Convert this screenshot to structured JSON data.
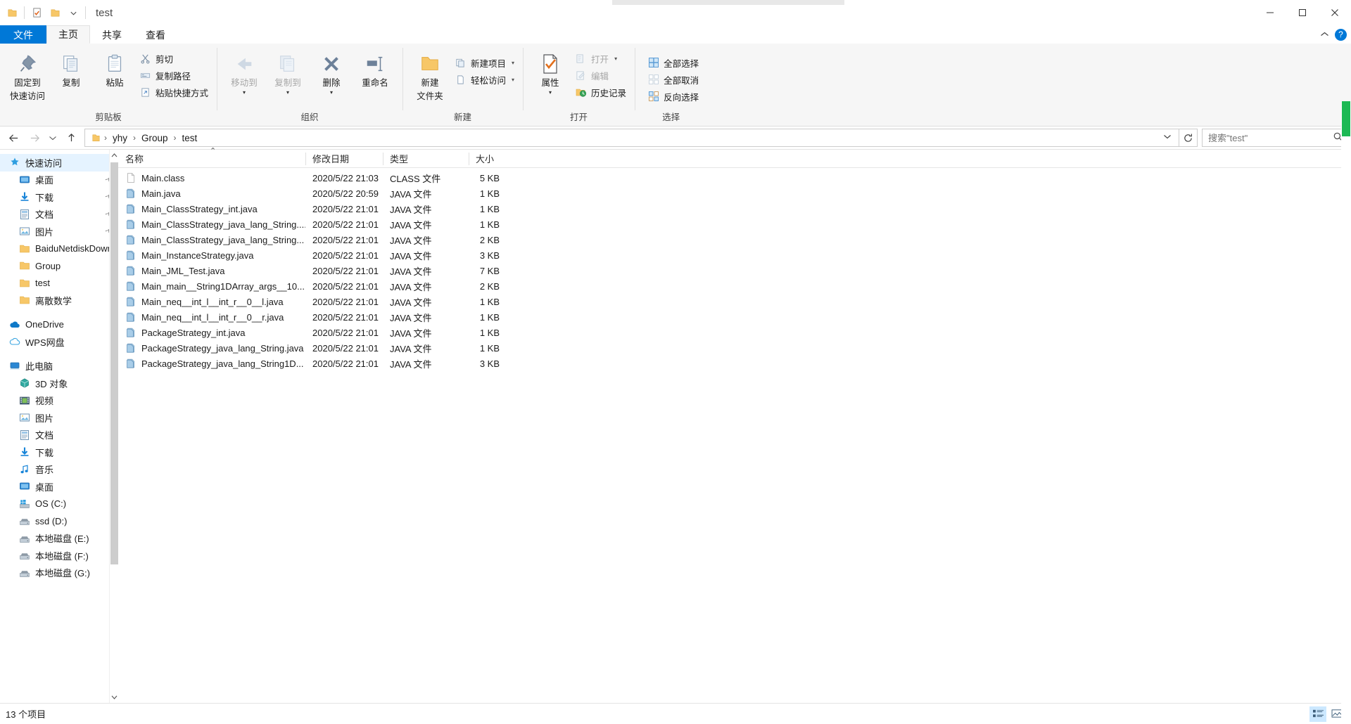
{
  "window": {
    "title": "test",
    "minimize_label": "─",
    "maximize_label": "☐",
    "close_label": "✕"
  },
  "quick_access_toolbar": [
    {
      "name": "properties-qat",
      "icon": "folder-icon"
    },
    {
      "name": "new-folder-qat",
      "icon": "checklist-icon"
    },
    {
      "name": "folder-qat",
      "icon": "folder-icon"
    },
    {
      "name": "customize-qat",
      "icon": "chevron-down-icon"
    }
  ],
  "tabs": [
    {
      "label": "文件",
      "key": "file"
    },
    {
      "label": "主页",
      "key": "home"
    },
    {
      "label": "共享",
      "key": "share"
    },
    {
      "label": "查看",
      "key": "view"
    }
  ],
  "ribbon": {
    "collapse_icon": "chevron-up-icon",
    "help_icon": "question-mark-icon",
    "groups": [
      {
        "label": "剪贴板",
        "big_buttons": [
          {
            "label": "固定到\n快速访问",
            "line1": "固定到",
            "line2": "快速访问",
            "icon": "pin-icon",
            "disabled": false
          },
          {
            "label": "复制",
            "line1": "复制",
            "line2": "",
            "icon": "copy-icon",
            "disabled": false
          },
          {
            "label": "粘贴",
            "line1": "粘贴",
            "line2": "",
            "icon": "paste-icon",
            "disabled": false
          }
        ],
        "small_buttons": [
          {
            "label": "剪切",
            "icon": "scissors-icon",
            "disabled": false
          },
          {
            "label": "复制路径",
            "icon": "copy-path-icon",
            "disabled": false
          },
          {
            "label": "粘贴快捷方式",
            "icon": "paste-shortcut-icon",
            "disabled": false
          }
        ]
      },
      {
        "label": "组织",
        "big_buttons": [
          {
            "line1": "移动到",
            "line2": "",
            "icon": "move-to-icon",
            "disabled": true,
            "caret": true
          },
          {
            "line1": "复制到",
            "line2": "",
            "icon": "copy-to-icon",
            "disabled": true,
            "caret": true
          },
          {
            "line1": "删除",
            "line2": "",
            "icon": "delete-x-icon",
            "disabled": false,
            "caret": true
          },
          {
            "line1": "重命名",
            "line2": "",
            "icon": "rename-icon",
            "disabled": false
          }
        ],
        "small_buttons": []
      },
      {
        "label": "新建",
        "big_buttons": [
          {
            "line1": "新建",
            "line2": "文件夹",
            "icon": "new-folder-icon",
            "disabled": false
          }
        ],
        "small_buttons": [
          {
            "label": "新建项目",
            "icon": "new-item-icon",
            "caret": true,
            "disabled": false
          },
          {
            "label": "轻松访问",
            "icon": "easy-access-icon",
            "caret": true,
            "disabled": false
          }
        ]
      },
      {
        "label": "打开",
        "big_buttons": [
          {
            "line1": "属性",
            "line2": "",
            "icon": "properties-check-icon",
            "disabled": false,
            "caret": true
          }
        ],
        "small_buttons": [
          {
            "label": "打开",
            "icon": "open-icon",
            "caret": true,
            "disabled": true
          },
          {
            "label": "编辑",
            "icon": "edit-icon",
            "disabled": true
          },
          {
            "label": "历史记录",
            "icon": "history-icon",
            "disabled": false
          }
        ]
      },
      {
        "label": "选择",
        "big_buttons": [],
        "small_buttons": [
          {
            "label": "全部选择",
            "icon": "select-all-icon",
            "disabled": false
          },
          {
            "label": "全部取消",
            "icon": "select-none-icon",
            "disabled": false
          },
          {
            "label": "反向选择",
            "icon": "invert-selection-icon",
            "disabled": false
          }
        ]
      }
    ]
  },
  "address": {
    "back_icon": "arrow-left-icon",
    "forward_icon": "arrow-right-icon",
    "recent_icon": "chevron-down-icon",
    "up_icon": "arrow-up-icon",
    "folder_icon": "folder-icon",
    "separator": "›",
    "crumbs": [
      "yhy",
      "Group",
      "test"
    ],
    "dropdown_icon": "chevron-down-icon",
    "refresh_icon": "refresh-icon"
  },
  "search": {
    "placeholder": "搜索\"test\"",
    "value": "",
    "icon": "search-icon"
  },
  "sidebar": {
    "items": [
      {
        "label": "快速访问",
        "icon": "star-icon",
        "level": 0,
        "selected": true,
        "pinned": false
      },
      {
        "label": "桌面",
        "icon": "desktop-icon",
        "level": 1,
        "selected": false,
        "pinned": true
      },
      {
        "label": "下载",
        "icon": "download-icon",
        "level": 1,
        "selected": false,
        "pinned": true
      },
      {
        "label": "文档",
        "icon": "documents-icon",
        "level": 1,
        "selected": false,
        "pinned": true
      },
      {
        "label": "图片",
        "icon": "pictures-icon",
        "level": 1,
        "selected": false,
        "pinned": true
      },
      {
        "label": "BaiduNetdiskDown",
        "icon": "folder-icon",
        "level": 1,
        "selected": false,
        "pinned": false
      },
      {
        "label": "Group",
        "icon": "folder-icon",
        "level": 1,
        "selected": false,
        "pinned": false
      },
      {
        "label": "test",
        "icon": "folder-icon",
        "level": 1,
        "selected": false,
        "pinned": false
      },
      {
        "label": "离散数学",
        "icon": "folder-icon",
        "level": 1,
        "selected": false,
        "pinned": false
      },
      {
        "label": "__GAP__",
        "icon": "",
        "level": 0,
        "selected": false,
        "pinned": false
      },
      {
        "label": "OneDrive",
        "icon": "onedrive-cloud-icon",
        "level": 0,
        "selected": false,
        "pinned": false
      },
      {
        "label": "WPS网盘",
        "icon": "wps-cloud-icon",
        "level": 0,
        "selected": false,
        "pinned": false
      },
      {
        "label": "__GAP__",
        "icon": "",
        "level": 0,
        "selected": false,
        "pinned": false
      },
      {
        "label": "此电脑",
        "icon": "this-pc-icon",
        "level": 0,
        "selected": false,
        "pinned": false
      },
      {
        "label": "3D 对象",
        "icon": "3d-objects-icon",
        "level": 1,
        "selected": false,
        "pinned": false
      },
      {
        "label": "视频",
        "icon": "videos-icon",
        "level": 1,
        "selected": false,
        "pinned": false
      },
      {
        "label": "图片",
        "icon": "pictures-icon",
        "level": 1,
        "selected": false,
        "pinned": false
      },
      {
        "label": "文档",
        "icon": "documents-icon",
        "level": 1,
        "selected": false,
        "pinned": false
      },
      {
        "label": "下载",
        "icon": "download-icon",
        "level": 1,
        "selected": false,
        "pinned": false
      },
      {
        "label": "音乐",
        "icon": "music-note-icon",
        "level": 1,
        "selected": false,
        "pinned": false
      },
      {
        "label": "桌面",
        "icon": "desktop-icon",
        "level": 1,
        "selected": false,
        "pinned": false
      },
      {
        "label": "OS (C:)",
        "icon": "windows-drive-icon",
        "level": 1,
        "selected": false,
        "pinned": false
      },
      {
        "label": "ssd (D:)",
        "icon": "drive-icon",
        "level": 1,
        "selected": false,
        "pinned": false
      },
      {
        "label": "本地磁盘 (E:)",
        "icon": "drive-icon",
        "level": 1,
        "selected": false,
        "pinned": false
      },
      {
        "label": "本地磁盘 (F:)",
        "icon": "drive-icon",
        "level": 1,
        "selected": false,
        "pinned": false
      },
      {
        "label": "本地磁盘 (G:)",
        "icon": "drive-icon",
        "level": 1,
        "selected": false,
        "pinned": false
      }
    ]
  },
  "filelist": {
    "columns": [
      {
        "label": "名称",
        "key": "name"
      },
      {
        "label": "修改日期",
        "key": "date"
      },
      {
        "label": "类型",
        "key": "type"
      },
      {
        "label": "大小",
        "key": "size"
      }
    ],
    "sort_indicator": "⌃",
    "rows": [
      {
        "name": "Main.class",
        "date": "2020/5/22 21:03",
        "type": "CLASS 文件",
        "size": "5 KB",
        "icon": "generic-file-icon"
      },
      {
        "name": "Main.java",
        "date": "2020/5/22 20:59",
        "type": "JAVA 文件",
        "size": "1 KB",
        "icon": "java-file-icon"
      },
      {
        "name": "Main_ClassStrategy_int.java",
        "date": "2020/5/22 21:01",
        "type": "JAVA 文件",
        "size": "1 KB",
        "icon": "java-file-icon"
      },
      {
        "name": "Main_ClassStrategy_java_lang_String....",
        "date": "2020/5/22 21:01",
        "type": "JAVA 文件",
        "size": "1 KB",
        "icon": "java-file-icon"
      },
      {
        "name": "Main_ClassStrategy_java_lang_String...",
        "date": "2020/5/22 21:01",
        "type": "JAVA 文件",
        "size": "2 KB",
        "icon": "java-file-icon"
      },
      {
        "name": "Main_InstanceStrategy.java",
        "date": "2020/5/22 21:01",
        "type": "JAVA 文件",
        "size": "3 KB",
        "icon": "java-file-icon"
      },
      {
        "name": "Main_JML_Test.java",
        "date": "2020/5/22 21:01",
        "type": "JAVA 文件",
        "size": "7 KB",
        "icon": "java-file-icon"
      },
      {
        "name": "Main_main__String1DArray_args__10...",
        "date": "2020/5/22 21:01",
        "type": "JAVA 文件",
        "size": "2 KB",
        "icon": "java-file-icon"
      },
      {
        "name": "Main_neq__int_l__int_r__0__l.java",
        "date": "2020/5/22 21:01",
        "type": "JAVA 文件",
        "size": "1 KB",
        "icon": "java-file-icon"
      },
      {
        "name": "Main_neq__int_l__int_r__0__r.java",
        "date": "2020/5/22 21:01",
        "type": "JAVA 文件",
        "size": "1 KB",
        "icon": "java-file-icon"
      },
      {
        "name": "PackageStrategy_int.java",
        "date": "2020/5/22 21:01",
        "type": "JAVA 文件",
        "size": "1 KB",
        "icon": "java-file-icon"
      },
      {
        "name": "PackageStrategy_java_lang_String.java",
        "date": "2020/5/22 21:01",
        "type": "JAVA 文件",
        "size": "1 KB",
        "icon": "java-file-icon"
      },
      {
        "name": "PackageStrategy_java_lang_String1D...",
        "date": "2020/5/22 21:01",
        "type": "JAVA 文件",
        "size": "3 KB",
        "icon": "java-file-icon"
      }
    ]
  },
  "statusbar": {
    "item_count": "13 个项目",
    "details_view_icon": "details-view-icon",
    "large_icons_view_icon": "large-icons-view-icon"
  },
  "colors": {
    "accent": "#0078d7",
    "selection": "#cce8ff",
    "nav_selection": "#e5f3ff",
    "ribbon_bg": "#f6f6f6",
    "scroll_thumb": "#1db954",
    "folder_yellow": "#ffd075"
  }
}
